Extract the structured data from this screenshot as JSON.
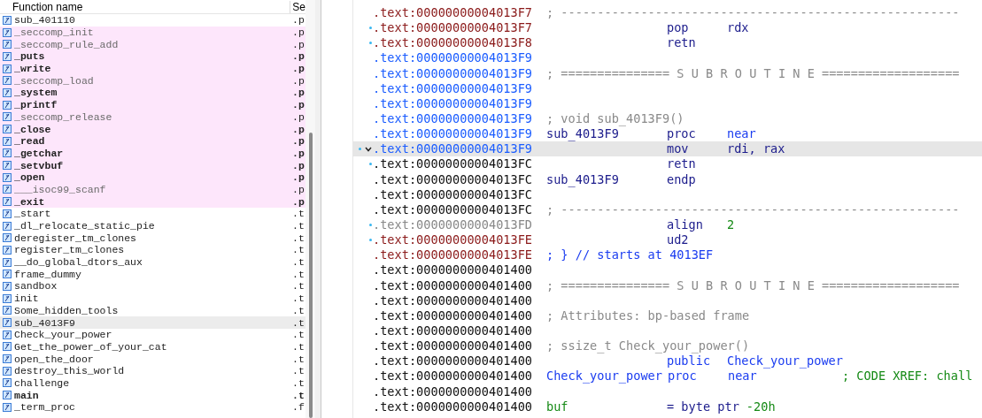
{
  "functions": {
    "columns": [
      "Function name",
      "Se"
    ],
    "rows": [
      {
        "name": "sub_401110",
        "segment": ".p",
        "imported": false,
        "bold": false,
        "dim": false,
        "selected": false
      },
      {
        "name": "_seccomp_init",
        "segment": ".p",
        "imported": true,
        "bold": false,
        "dim": true,
        "selected": false
      },
      {
        "name": "_seccomp_rule_add",
        "segment": ".p",
        "imported": true,
        "bold": false,
        "dim": true,
        "selected": false
      },
      {
        "name": "_puts",
        "segment": ".p",
        "imported": true,
        "bold": true,
        "dim": false,
        "selected": false
      },
      {
        "name": "_write",
        "segment": ".p",
        "imported": true,
        "bold": true,
        "dim": false,
        "selected": false
      },
      {
        "name": "_seccomp_load",
        "segment": ".p",
        "imported": true,
        "bold": false,
        "dim": true,
        "selected": false
      },
      {
        "name": "_system",
        "segment": ".p",
        "imported": true,
        "bold": true,
        "dim": false,
        "selected": false
      },
      {
        "name": "_printf",
        "segment": ".p",
        "imported": true,
        "bold": true,
        "dim": false,
        "selected": false
      },
      {
        "name": "_seccomp_release",
        "segment": ".p",
        "imported": true,
        "bold": false,
        "dim": true,
        "selected": false
      },
      {
        "name": "_close",
        "segment": ".p",
        "imported": true,
        "bold": true,
        "dim": false,
        "selected": false
      },
      {
        "name": "_read",
        "segment": ".p",
        "imported": true,
        "bold": true,
        "dim": false,
        "selected": false
      },
      {
        "name": "_getchar",
        "segment": ".p",
        "imported": true,
        "bold": true,
        "dim": false,
        "selected": false
      },
      {
        "name": "_setvbuf",
        "segment": ".p",
        "imported": true,
        "bold": true,
        "dim": false,
        "selected": false
      },
      {
        "name": "_open",
        "segment": ".p",
        "imported": true,
        "bold": true,
        "dim": false,
        "selected": false
      },
      {
        "name": "___isoc99_scanf",
        "segment": ".p",
        "imported": true,
        "bold": false,
        "dim": true,
        "selected": false
      },
      {
        "name": "_exit",
        "segment": ".p",
        "imported": true,
        "bold": true,
        "dim": false,
        "selected": false
      },
      {
        "name": "_start",
        "segment": ".t",
        "imported": false,
        "bold": false,
        "dim": false,
        "selected": false
      },
      {
        "name": "_dl_relocate_static_pie",
        "segment": ".t",
        "imported": false,
        "bold": false,
        "dim": false,
        "selected": false
      },
      {
        "name": "deregister_tm_clones",
        "segment": ".t",
        "imported": false,
        "bold": false,
        "dim": false,
        "selected": false
      },
      {
        "name": "register_tm_clones",
        "segment": ".t",
        "imported": false,
        "bold": false,
        "dim": false,
        "selected": false
      },
      {
        "name": "__do_global_dtors_aux",
        "segment": ".t",
        "imported": false,
        "bold": false,
        "dim": false,
        "selected": false
      },
      {
        "name": "frame_dummy",
        "segment": ".t",
        "imported": false,
        "bold": false,
        "dim": false,
        "selected": false
      },
      {
        "name": "sandbox",
        "segment": ".t",
        "imported": false,
        "bold": false,
        "dim": false,
        "selected": false
      },
      {
        "name": "init",
        "segment": ".t",
        "imported": false,
        "bold": false,
        "dim": false,
        "selected": false
      },
      {
        "name": "Some_hidden_tools",
        "segment": ".t",
        "imported": false,
        "bold": false,
        "dim": false,
        "selected": false
      },
      {
        "name": "sub_4013F9",
        "segment": ".t",
        "imported": false,
        "bold": false,
        "dim": false,
        "selected": true
      },
      {
        "name": "Check_your_power",
        "segment": ".t",
        "imported": false,
        "bold": false,
        "dim": false,
        "selected": false
      },
      {
        "name": "Get_the_power_of_your_cat",
        "segment": ".t",
        "imported": false,
        "bold": false,
        "dim": false,
        "selected": false
      },
      {
        "name": "open_the_door",
        "segment": ".t",
        "imported": false,
        "bold": false,
        "dim": false,
        "selected": false
      },
      {
        "name": "destroy_this_world",
        "segment": ".t",
        "imported": false,
        "bold": false,
        "dim": false,
        "selected": false
      },
      {
        "name": "challenge",
        "segment": ".t",
        "imported": false,
        "bold": false,
        "dim": false,
        "selected": false
      },
      {
        "name": "main",
        "segment": ".t",
        "imported": false,
        "bold": true,
        "dim": false,
        "selected": false
      },
      {
        "name": "_term_proc",
        "segment": ".f",
        "imported": false,
        "bold": false,
        "dim": false,
        "selected": false
      }
    ]
  },
  "disassembly": [
    {
      "address": {
        "text": ".text:00000000004013F7",
        "color": "#8b1a1a"
      },
      "marker": false,
      "selected": false,
      "collapse": false,
      "comment": {
        "text": "; -------------------------------------------------------",
        "color": "#8a8a8a"
      }
    },
    {
      "address": {
        "text": ".text:00000000004013F7",
        "color": "#8b1a1a"
      },
      "marker": true,
      "selected": false,
      "collapse": false,
      "mnemonic": {
        "text": "pop",
        "color": "#1c1c8c"
      },
      "operand": {
        "text": "rdx",
        "color": "#1c1c8c"
      }
    },
    {
      "address": {
        "text": ".text:00000000004013F8",
        "color": "#8b1a1a"
      },
      "marker": true,
      "selected": false,
      "collapse": false,
      "mnemonic": {
        "text": "retn",
        "color": "#1c1c8c"
      }
    },
    {
      "address": {
        "text": ".text:00000000004013F9",
        "color": "#1a5cff"
      },
      "marker": false,
      "selected": false,
      "collapse": false
    },
    {
      "address": {
        "text": ".text:00000000004013F9",
        "color": "#1a5cff"
      },
      "marker": false,
      "selected": false,
      "collapse": false,
      "comment": {
        "text": "; =============== S U B R O U T I N E ===================",
        "color": "#8a8a8a"
      }
    },
    {
      "address": {
        "text": ".text:00000000004013F9",
        "color": "#1a5cff"
      },
      "marker": false,
      "selected": false,
      "collapse": false
    },
    {
      "address": {
        "text": ".text:00000000004013F9",
        "color": "#1a5cff"
      },
      "marker": false,
      "selected": false,
      "collapse": false
    },
    {
      "address": {
        "text": ".text:00000000004013F9",
        "color": "#1a5cff"
      },
      "marker": false,
      "selected": false,
      "collapse": false,
      "comment": {
        "text": "; void sub_4013F9()",
        "color": "#8a8a8a"
      }
    },
    {
      "address": {
        "text": ".text:00000000004013F9",
        "color": "#1a5cff"
      },
      "marker": false,
      "selected": false,
      "collapse": false,
      "label": {
        "text": "sub_4013F9",
        "color": "#1c1c8c"
      },
      "mnemonic": {
        "text": "proc",
        "color": "#1c1c8c"
      },
      "operand": {
        "text": "near",
        "color": "#1a3cf0"
      }
    },
    {
      "address": {
        "text": ".text:00000000004013F9",
        "color": "#1a5cff"
      },
      "marker": true,
      "selected": true,
      "collapse": true,
      "mnemonic": {
        "text": "mov",
        "color": "#1c1c8c"
      },
      "operand": {
        "text": "rdi, rax",
        "color": "#1c1c8c"
      }
    },
    {
      "address": {
        "text": ".text:00000000004013FC",
        "color": "#111111"
      },
      "marker": true,
      "selected": false,
      "collapse": false,
      "mnemonic": {
        "text": "retn",
        "color": "#1c1c8c"
      }
    },
    {
      "address": {
        "text": ".text:00000000004013FC",
        "color": "#111111"
      },
      "marker": false,
      "selected": false,
      "collapse": false,
      "label": {
        "text": "sub_4013F9",
        "color": "#1c1c8c"
      },
      "mnemonic": {
        "text": "endp",
        "color": "#1c1c8c"
      }
    },
    {
      "address": {
        "text": ".text:00000000004013FC",
        "color": "#111111"
      },
      "marker": false,
      "selected": false,
      "collapse": false
    },
    {
      "address": {
        "text": ".text:00000000004013FC",
        "color": "#111111"
      },
      "marker": false,
      "selected": false,
      "collapse": false,
      "comment": {
        "text": "; -------------------------------------------------------",
        "color": "#8a8a8a"
      }
    },
    {
      "address": {
        "text": ".text:00000000004013FD",
        "color": "#888888"
      },
      "marker": true,
      "selected": false,
      "collapse": false,
      "mnemonic": {
        "text": "align",
        "color": "#1c1c8c"
      },
      "operand": {
        "text": "2",
        "color": "#168a16"
      }
    },
    {
      "address": {
        "text": ".text:00000000004013FE",
        "color": "#8b1a1a"
      },
      "marker": true,
      "selected": false,
      "collapse": false,
      "mnemonic": {
        "text": "ud2",
        "color": "#1c1c8c"
      }
    },
    {
      "address": {
        "text": ".text:00000000004013FE",
        "color": "#8b1a1a"
      },
      "marker": false,
      "selected": false,
      "collapse": false,
      "comment": {
        "text": "; } // starts at 4013EF",
        "color": "#1a3cf0"
      }
    },
    {
      "address": {
        "text": ".text:0000000000401400",
        "color": "#111111"
      },
      "marker": false,
      "selected": false,
      "collapse": false
    },
    {
      "address": {
        "text": ".text:0000000000401400",
        "color": "#111111"
      },
      "marker": false,
      "selected": false,
      "collapse": false,
      "comment": {
        "text": "; =============== S U B R O U T I N E ===================",
        "color": "#8a8a8a"
      }
    },
    {
      "address": {
        "text": ".text:0000000000401400",
        "color": "#111111"
      },
      "marker": false,
      "selected": false,
      "collapse": false
    },
    {
      "address": {
        "text": ".text:0000000000401400",
        "color": "#111111"
      },
      "marker": false,
      "selected": false,
      "collapse": false,
      "comment": {
        "text": "; Attributes: bp-based frame",
        "color": "#8a8a8a"
      }
    },
    {
      "address": {
        "text": ".text:0000000000401400",
        "color": "#111111"
      },
      "marker": false,
      "selected": false,
      "collapse": false
    },
    {
      "address": {
        "text": ".text:0000000000401400",
        "color": "#111111"
      },
      "marker": false,
      "selected": false,
      "collapse": false,
      "comment": {
        "text": "; ssize_t Check_your_power()",
        "color": "#8a8a8a"
      }
    },
    {
      "address": {
        "text": ".text:0000000000401400",
        "color": "#111111"
      },
      "marker": false,
      "selected": false,
      "collapse": false,
      "mnemonic": {
        "text": "public",
        "color": "#1a3cf0"
      },
      "operand": {
        "text": "Check_your_power",
        "color": "#1a3cf0"
      }
    },
    {
      "address": {
        "text": ".text:0000000000401400",
        "color": "#111111"
      },
      "marker": false,
      "selected": false,
      "collapse": false,
      "label": {
        "text": "Check_your_power",
        "color": "#1a3cf0"
      },
      "mnemonic": {
        "text": "proc",
        "color": "#1a3cf0"
      },
      "operand": {
        "text": "near",
        "color": "#1a3cf0"
      },
      "xref": {
        "text": "; CODE XREF: chall",
        "color": "#168a16"
      }
    },
    {
      "address": {
        "text": ".text:0000000000401400",
        "color": "#111111"
      },
      "marker": false,
      "selected": false,
      "collapse": false
    },
    {
      "address": {
        "text": ".text:0000000000401400",
        "color": "#111111"
      },
      "marker": false,
      "selected": false,
      "collapse": false,
      "label": {
        "text": "buf",
        "color": "#168a16"
      },
      "mnemonic": {
        "text": "= byte ptr",
        "color": "#1c1c8c"
      },
      "operand": {
        "text": "-20h",
        "color": "#168a16"
      }
    }
  ]
}
